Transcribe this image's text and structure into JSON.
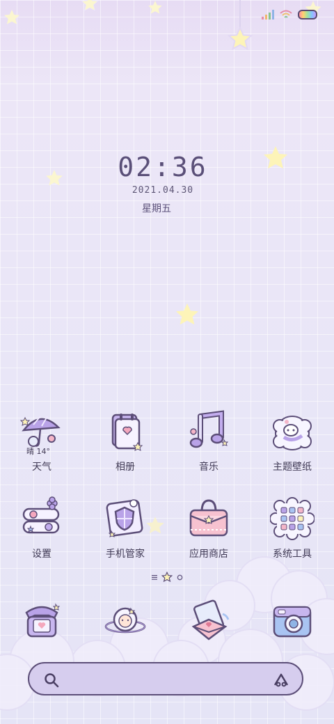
{
  "status_bar": {
    "signal_icon": "signal-icon",
    "wifi_icon": "wifi-icon",
    "battery_icon": "battery-icon"
  },
  "clock": {
    "time": "02:36",
    "date": "2021.04.30",
    "weekday": "星期五"
  },
  "apps_row1": [
    {
      "label": "天气",
      "icon": "umbrella-weather-icon",
      "extra": "晴 14°"
    },
    {
      "label": "相册",
      "icon": "calendar-photo-icon"
    },
    {
      "label": "音乐",
      "icon": "music-note-icon"
    },
    {
      "label": "主题壁纸",
      "icon": "sheep-theme-icon"
    }
  ],
  "apps_row2": [
    {
      "label": "设置",
      "icon": "settings-toggle-icon"
    },
    {
      "label": "手机管家",
      "icon": "shield-manager-icon"
    },
    {
      "label": "应用商店",
      "icon": "shopping-bag-icon"
    },
    {
      "label": "系统工具",
      "icon": "tools-folder-icon"
    }
  ],
  "dock": [
    {
      "icon": "phone-icon"
    },
    {
      "icon": "messages-icon"
    },
    {
      "icon": "browser-icon"
    },
    {
      "icon": "camera-icon"
    }
  ],
  "search": {
    "search_icon": "search-icon",
    "assistant_icon": "assistant-icon"
  },
  "colors": {
    "outline": "#5c4e78",
    "accent_purple": "#b7a2e6",
    "accent_pink": "#f4b6c8",
    "accent_blue": "#a9c4f2",
    "star": "#fdf3b8"
  }
}
